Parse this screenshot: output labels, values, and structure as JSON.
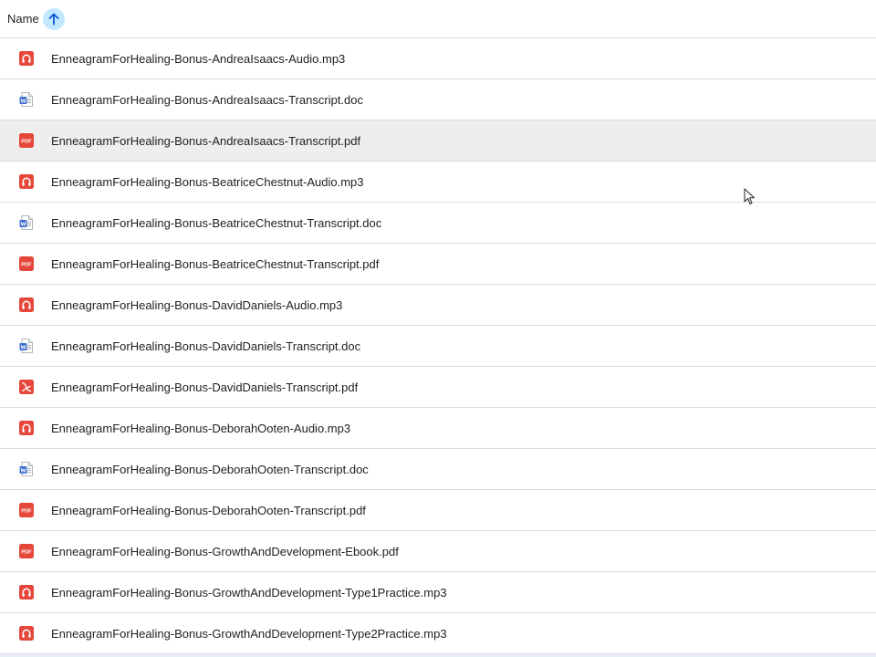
{
  "header": {
    "name_label": "Name",
    "sort_icon": "arrow-upward-icon"
  },
  "colors": {
    "audio_icon": "#e5483b",
    "pdf_icon": "#e5483b",
    "doc_icon": "#3f6fd1",
    "sort_badge": "#c2e7ff",
    "selected_row": "#eeeeee"
  },
  "files": [
    {
      "name": "EnneagramForHealing-Bonus-AndreaIsaacs-Audio.mp3",
      "type": "audio"
    },
    {
      "name": "EnneagramForHealing-Bonus-AndreaIsaacs-Transcript.doc",
      "type": "doc"
    },
    {
      "name": "EnneagramForHealing-Bonus-AndreaIsaacs-Transcript.pdf",
      "type": "pdf",
      "selected": true
    },
    {
      "name": "EnneagramForHealing-Bonus-BeatriceChestnut-Audio.mp3",
      "type": "audio"
    },
    {
      "name": "EnneagramForHealing-Bonus-BeatriceChestnut-Transcript.doc",
      "type": "doc"
    },
    {
      "name": "EnneagramForHealing-Bonus-BeatriceChestnut-Transcript.pdf",
      "type": "pdf"
    },
    {
      "name": "EnneagramForHealing-Bonus-DavidDaniels-Audio.mp3",
      "type": "audio"
    },
    {
      "name": "EnneagramForHealing-Bonus-DavidDaniels-Transcript.doc",
      "type": "doc"
    },
    {
      "name": "EnneagramForHealing-Bonus-DavidDaniels-Transcript.pdf",
      "type": "pdf-alt"
    },
    {
      "name": "EnneagramForHealing-Bonus-DeborahOoten-Audio.mp3",
      "type": "audio"
    },
    {
      "name": "EnneagramForHealing-Bonus-DeborahOoten-Transcript.doc",
      "type": "doc"
    },
    {
      "name": "EnneagramForHealing-Bonus-DeborahOoten-Transcript.pdf",
      "type": "pdf"
    },
    {
      "name": "EnneagramForHealing-Bonus-GrowthAndDevelopment-Ebook.pdf",
      "type": "pdf"
    },
    {
      "name": "EnneagramForHealing-Bonus-GrowthAndDevelopment-Type1Practice.mp3",
      "type": "audio"
    },
    {
      "name": "EnneagramForHealing-Bonus-GrowthAndDevelopment-Type2Practice.mp3",
      "type": "audio"
    }
  ]
}
